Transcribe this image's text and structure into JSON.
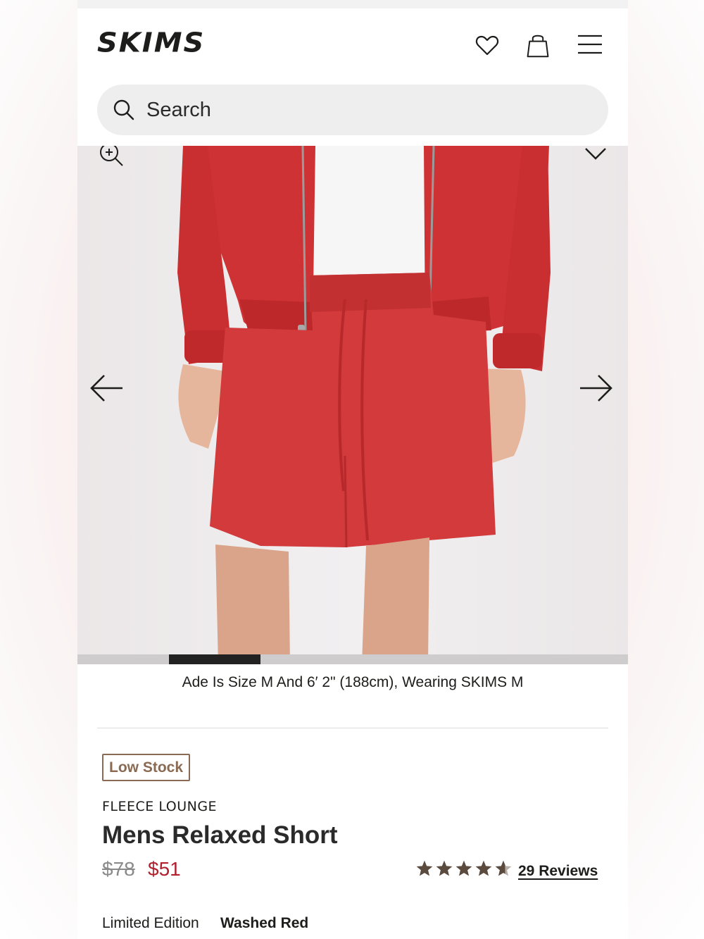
{
  "header": {
    "logo": "SKIMS",
    "search_placeholder": "Search"
  },
  "icons": {
    "wishlist": "heart-icon",
    "bag": "shopping-bag-icon",
    "menu": "hamburger-menu-icon",
    "search": "search-icon",
    "zoom": "zoom-in-icon",
    "prev": "arrow-left-icon",
    "next": "arrow-right-icon",
    "chevron": "chevron-down-icon",
    "star": "star-icon"
  },
  "gallery": {
    "caption": "Ade Is Size M And 6′ 2\" (188cm), Wearing SKIMS M",
    "active_slide_fraction_start": 0.167,
    "active_slide_fraction_width": 0.167
  },
  "product": {
    "badge": "Low Stock",
    "collection": "FLEECE LOUNGE",
    "title": "Mens Relaxed Short",
    "price_original": "$78",
    "price_sale": "$51",
    "rating": 4.5,
    "reviews_label": "29 Reviews",
    "edition_label": "Limited Edition",
    "color_name": "Washed Red"
  },
  "colors": {
    "accent_sale": "#b21f2d",
    "badge": "#8a6a52",
    "garment": "#d23a3c"
  }
}
